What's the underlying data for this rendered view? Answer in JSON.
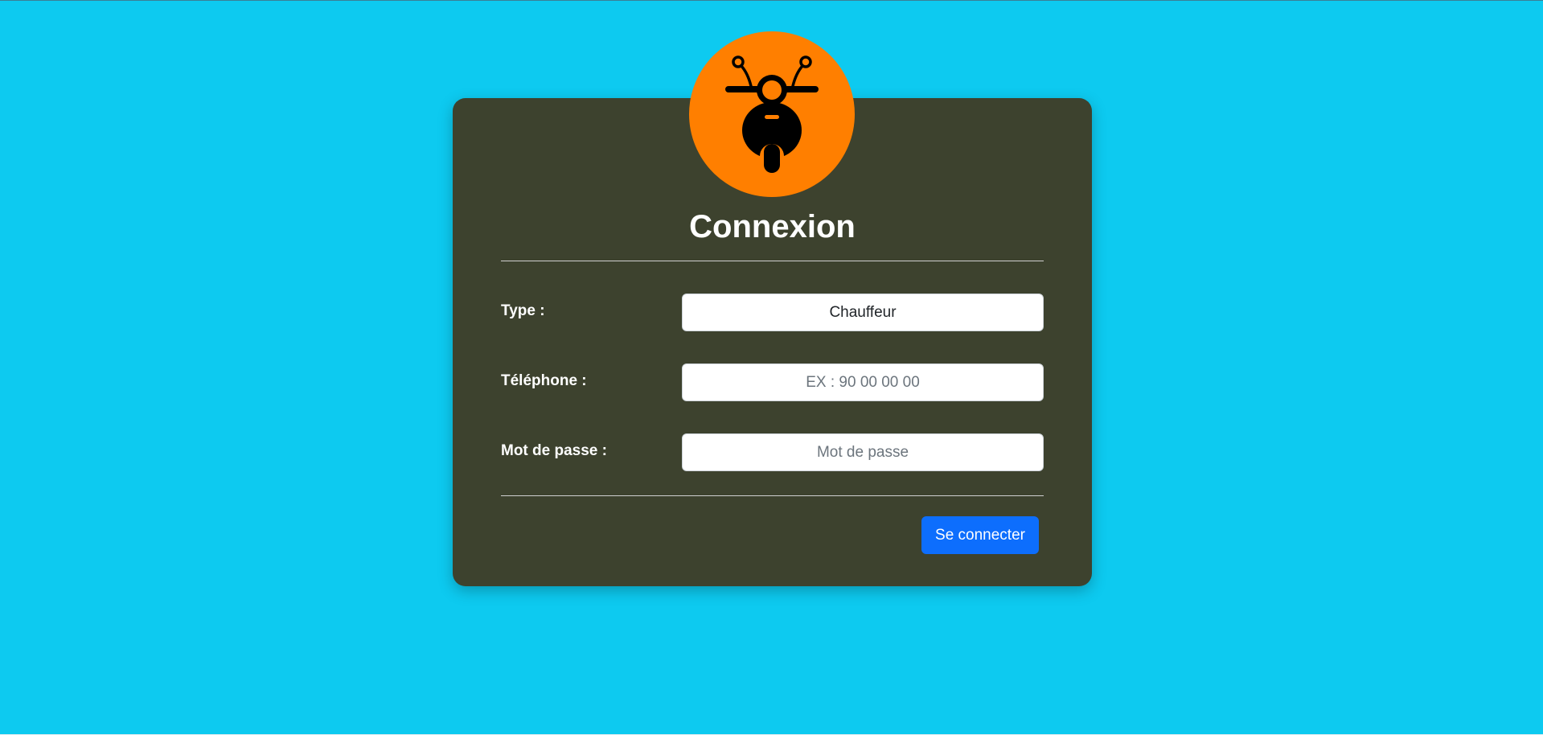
{
  "login": {
    "title": "Connexion",
    "fields": {
      "type": {
        "label": "Type :",
        "value": "Chauffeur"
      },
      "telephone": {
        "label": "Téléphone :",
        "placeholder": "EX : 90 00 00 00",
        "value": ""
      },
      "password": {
        "label": "Mot de passe :",
        "placeholder": "Mot de passe",
        "value": ""
      }
    },
    "submit_label": "Se connecter"
  },
  "icons": {
    "logo": "motorbike-icon"
  },
  "colors": {
    "page_background": "#0dcaf0",
    "card_background": "#3d422e",
    "logo_background": "#ff7f00",
    "button_primary": "#0d6efd",
    "text_light": "#ffffff"
  }
}
